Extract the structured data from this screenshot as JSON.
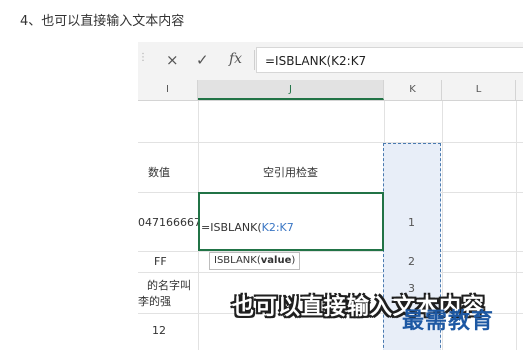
{
  "caption": "4、也可以直接输入文本内容",
  "formula_bar": {
    "cancel_icon": "×",
    "enter_icon": "✓",
    "fx_label": "fx",
    "formula": "=ISBLANK(K2:K7"
  },
  "columns": [
    "I",
    "J",
    "K",
    "L"
  ],
  "headers": {
    "I": "数值",
    "J": "空引用检查"
  },
  "rows": [
    {
      "I": "047166667",
      "K": "1"
    },
    {
      "I": "FF",
      "K": "2"
    },
    {
      "I_line1": "的名字叫",
      "I_line2": "李的强",
      "K": "3"
    },
    {
      "I": "12"
    }
  ],
  "editing": {
    "prefix": "=ISBLANK(",
    "ref": "K2:K7",
    "ref_color": "#3a76c4"
  },
  "tooltip": {
    "func": "ISBLANK(",
    "arg": "value",
    "close": ")"
  },
  "overlay_text": "也可以直接输入文本内容",
  "watermark": "最需教育",
  "colors": {
    "accent": "#217346",
    "selection": "#4a7ab0",
    "logo": "#1d58a3"
  }
}
